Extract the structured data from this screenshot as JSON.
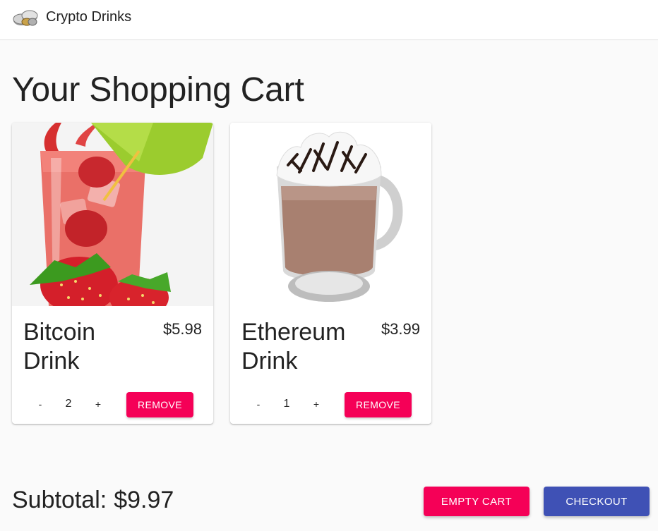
{
  "header": {
    "brand": "Crypto Drinks",
    "logo_icon": "coins-logo"
  },
  "page": {
    "title": "Your Shopping Cart"
  },
  "cart": {
    "items": [
      {
        "name": "Bitcoin Drink",
        "price": "$5.98",
        "quantity": "2",
        "minus_label": "-",
        "plus_label": "+",
        "remove_label": "REMOVE",
        "image": "strawberry-drink-image"
      },
      {
        "name": "Ethereum Drink",
        "price": "$3.99",
        "quantity": "1",
        "minus_label": "-",
        "plus_label": "+",
        "remove_label": "REMOVE",
        "image": "hot-chocolate-image"
      }
    ]
  },
  "footer": {
    "subtotal_label": "Subtotal:",
    "subtotal_value": "$9.97",
    "empty_cart_label": "EMPTY CART",
    "checkout_label": "CHECKOUT"
  },
  "colors": {
    "accent_pink": "#f50057",
    "primary_indigo": "#3f51b5",
    "background": "#fafafa"
  }
}
